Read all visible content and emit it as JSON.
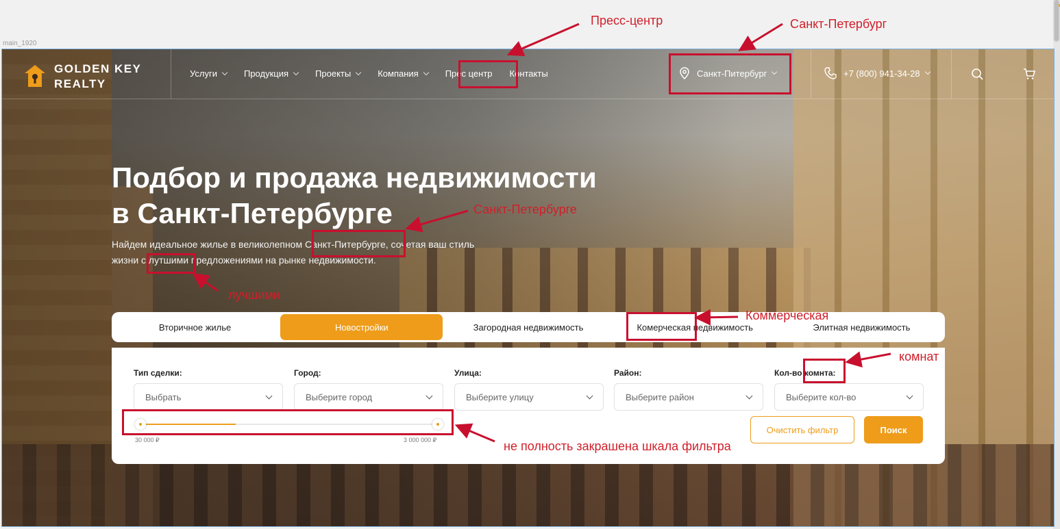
{
  "frame_label": "main_1920",
  "header": {
    "logo_line1": "GOLDEN KEY",
    "logo_line2": "REALTY",
    "nav": [
      {
        "label": "Услуги",
        "has_chevron": true
      },
      {
        "label": "Продукция",
        "has_chevron": true
      },
      {
        "label": "Проекты",
        "has_chevron": true
      },
      {
        "label": "Компания",
        "has_chevron": true
      },
      {
        "label": "Прес центр",
        "has_chevron": false
      },
      {
        "label": "Контакты",
        "has_chevron": false
      }
    ],
    "city": "Санкт-Питербург",
    "phone": "+7 (800) 941-34-28"
  },
  "hero": {
    "title_line1": "Подбор и продажа недвижимости",
    "title_line2": "в Санкт-Петербурге",
    "subtitle_line1": "Найдем идеальное жилье в великолепном Санкт-Питербурге, сочетая ваш стиль",
    "subtitle_line2": "жизни с лутшими предложениями на рынке недвижимости."
  },
  "tabs": [
    {
      "label": "Вторичное жилье",
      "active": false
    },
    {
      "label": "Новостройки",
      "active": true
    },
    {
      "label": "Загородная недвижимость",
      "active": false
    },
    {
      "label": "Комерческая недвижимость",
      "active": false
    },
    {
      "label": "Элитная недвижимость",
      "active": false
    }
  ],
  "filter": {
    "fields": [
      {
        "label": "Тип сделки:",
        "placeholder": "Выбрать"
      },
      {
        "label": "Город:",
        "placeholder": "Выберите город"
      },
      {
        "label": "Улица:",
        "placeholder": "Выберите улицу"
      },
      {
        "label": "Район:",
        "placeholder": "Выберите район"
      },
      {
        "label": "Кол-во комнта:",
        "placeholder": "Выберите кол-во"
      }
    ],
    "price_min": "30 000 ₽",
    "price_max": "3 000 000 ₽",
    "slider_fill_fraction": 0.32,
    "clear_label": "Очистить фильтр",
    "search_label": "Поиск"
  },
  "annotations": {
    "press": "Пресс-центр",
    "spb_header": "Санкт-Петербург",
    "spb_text": "Санкт-Петербурге",
    "best": "лучшими",
    "commercial": "Коммерческая",
    "rooms": "комнат",
    "slider": "не полность закрашена шкала фильтра"
  },
  "colors": {
    "accent": "#ee9c1a",
    "annotation": "#c8102e"
  }
}
